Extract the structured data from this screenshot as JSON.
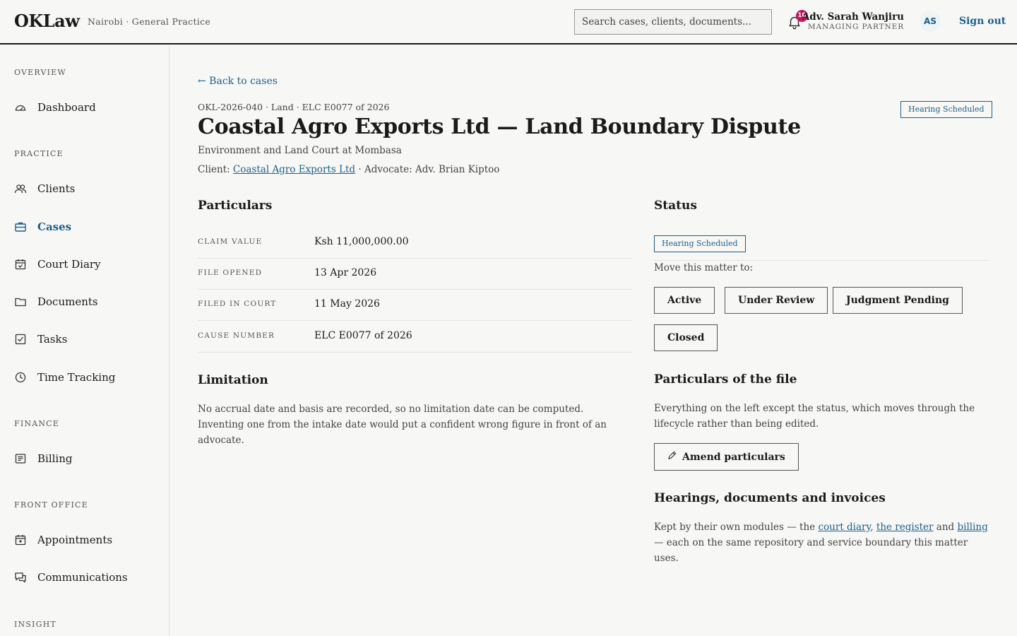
{
  "header": {
    "logo": "OKLaw",
    "firm": "Nairobi · General Practice",
    "search_placeholder": "Search cases, clients, documents...",
    "notifications_count": "10",
    "user_name": "Adv. Sarah Wanjiru",
    "user_role": "MANAGING PARTNER",
    "avatar_initials": "AS",
    "sign_out": "Sign out"
  },
  "sidebar": {
    "sections": {
      "overview": "OVERVIEW",
      "practice": "PRACTICE",
      "finance": "FINANCE",
      "front_office": "FRONT OFFICE",
      "insight": "INSIGHT"
    },
    "items": {
      "dashboard": "Dashboard",
      "clients": "Clients",
      "cases": "Cases",
      "court_diary": "Court Diary",
      "documents": "Documents",
      "tasks": "Tasks",
      "time_tracking": "Time Tracking",
      "billing": "Billing",
      "appointments": "Appointments",
      "communications": "Communications"
    },
    "active_item": "cases"
  },
  "case": {
    "back_link": "← Back to cases",
    "meta": "OKL-2026-040 · Land · ELC E0077 of 2026",
    "title": "Coastal Agro Exports Ltd — Land Boundary Dispute",
    "status_badge": "Hearing Scheduled",
    "court": "Environment and Land Court at Mombasa",
    "client_prefix": "Client:",
    "client_name": "Coastal Agro Exports Ltd",
    "advocate_text": "· Advocate: Adv. Brian Kiptoo"
  },
  "particulars": {
    "heading": "Particulars",
    "rows": [
      {
        "label": "CLAIM VALUE",
        "value": "Ksh 11,000,000.00"
      },
      {
        "label": "FILE OPENED",
        "value": "13 Apr 2026"
      },
      {
        "label": "FILED IN COURT",
        "value": "11 May 2026"
      },
      {
        "label": "CAUSE NUMBER",
        "value": "ELC E0077 of 2026"
      }
    ]
  },
  "limitation": {
    "heading": "Limitation",
    "text": "No accrual date and basis are recorded, so no limitation date can be computed. Inventing one from the intake date would put a confident wrong figure in front of an advocate."
  },
  "status": {
    "heading": "Status",
    "current": "Hearing Scheduled",
    "move_label": "Move this matter to:",
    "options": [
      "Active",
      "Under Review",
      "Judgment Pending",
      "Closed"
    ]
  },
  "file_particulars": {
    "heading": "Particulars of the file",
    "text": "Everything on the left except the status, which moves through the lifecycle rather than being edited.",
    "button": "Amend particulars"
  },
  "hearings": {
    "heading": "Hearings, documents and invoices",
    "prefix": "Kept by their own modules — the ",
    "link1": "court diary",
    "sep1": ", ",
    "link2": "the register",
    "sep2": " and ",
    "link3": "billing",
    "suffix": " — each on the same repository and service boundary this matter uses."
  },
  "colors": {
    "accent": "#1d5f8a",
    "badge_red": "#c0175d",
    "border_dark": "#1a1a1a"
  }
}
